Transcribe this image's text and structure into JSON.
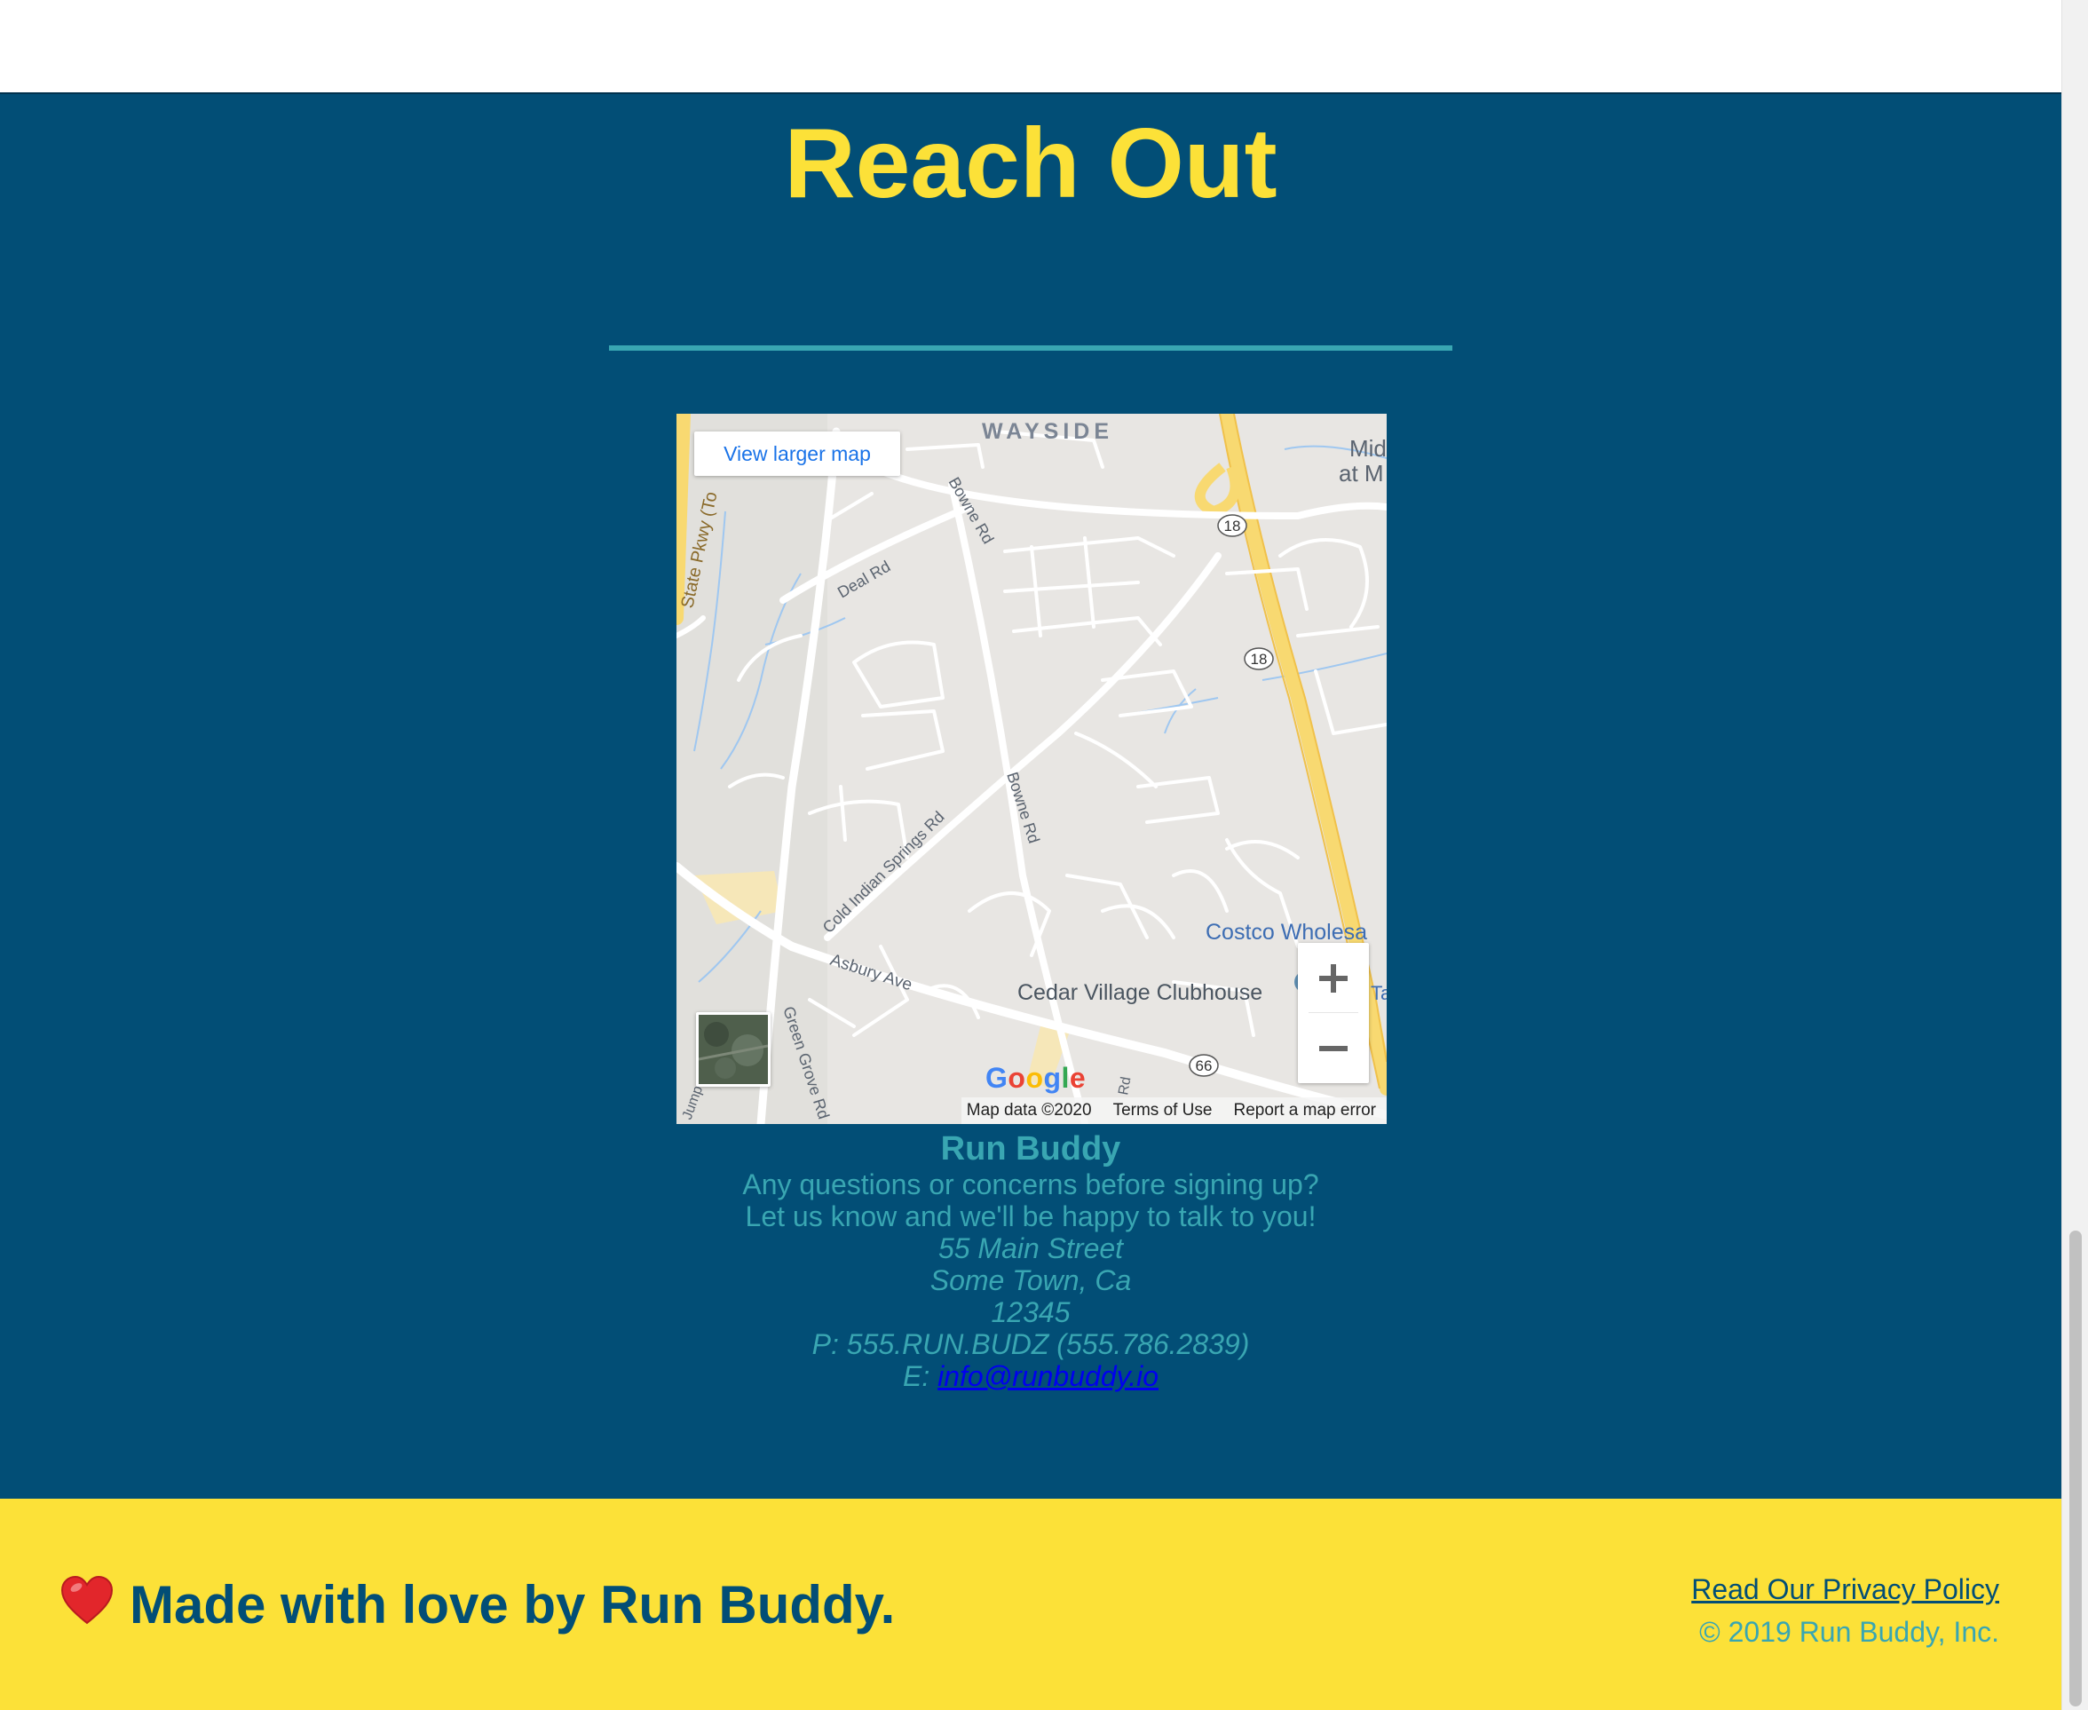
{
  "colors": {
    "navy": "#024e76",
    "yellow": "#fce138",
    "teal": "#39a6b2"
  },
  "contact_section": {
    "title": "Reach Out",
    "map": {
      "view_larger": "View larger map",
      "labels": {
        "wayside": "WAYSIDE",
        "mid_top": "Mid",
        "mid_bottom": "at M",
        "state_pkwy": "State Pkwy (To",
        "bowne_rd_top": "Bowne Rd",
        "deal_rd": "Deal Rd",
        "route18_a": "18",
        "route18_b": "18",
        "bowne_rd_mid": "Bowne Rd",
        "cold_indian": "Cold Indian Springs Rd",
        "asbury": "Asbury Ave",
        "cedar_village": "Cedar Village Clubhouse",
        "costco": "Costco Wholesa",
        "route66": "66",
        "green_grove": "Green Grove Rd",
        "jump": "Jump",
        "ta": "Ta",
        "rd_bottom": "Rd"
      },
      "attribution": [
        "Map data ©2020",
        "Terms of Use",
        "Report a map error"
      ],
      "zoom_in": "+",
      "zoom_out": "−",
      "logo": [
        "G",
        "o",
        "o",
        "g",
        "l",
        "e"
      ]
    },
    "info": {
      "name": "Run Buddy",
      "line1": "Any questions or concerns before signing up?",
      "line2": "Let us know and we'll be happy to talk to you!",
      "street": "55 Main Street",
      "city": "Some Town, Ca",
      "zip": "12345",
      "phone": "P: 555.RUN.BUDZ (555.786.2839)",
      "email_prefix": "E:",
      "email": "info@runbuddy.io"
    }
  },
  "footer": {
    "heart_icon": "heart-icon",
    "made_with": "Made with love by Run Buddy.",
    "privacy": "Read Our Privacy Policy",
    "copyright": "© 2019 Run Buddy, Inc."
  }
}
